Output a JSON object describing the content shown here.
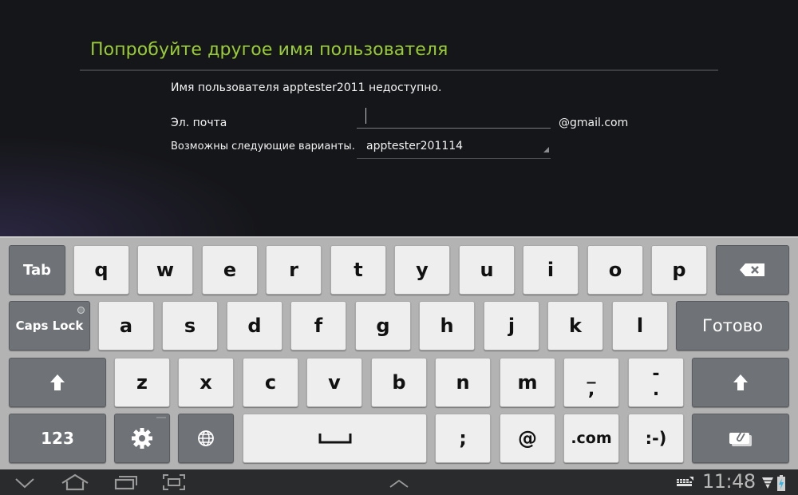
{
  "screen": {
    "title": "Попробуйте другое имя пользователя",
    "message": "Имя пользователя apptester2011 недоступно.",
    "email_label": "Эл. почта",
    "email_value": "",
    "email_domain": "@gmail.com",
    "variants_label": "Возможны следующие варианты.",
    "variants_selected": "apptester201114"
  },
  "keyboard": {
    "row1": [
      "q",
      "w",
      "e",
      "r",
      "t",
      "y",
      "u",
      "i",
      "o",
      "p"
    ],
    "row2": [
      "a",
      "s",
      "d",
      "f",
      "g",
      "h",
      "j",
      "k",
      "l"
    ],
    "row3": [
      "z",
      "x",
      "c",
      "v",
      "b",
      "n",
      "m"
    ],
    "tab_label": "Tab",
    "caps_label": "Caps Lock",
    "done_label": "Готово",
    "numbers_label": "123",
    "comma_key": {
      "top": "_",
      "bottom": ","
    },
    "period_key": {
      "top": "-",
      "bottom": "."
    },
    "semicolon_label": ";",
    "at_label": "@",
    "dotcom_label": ".com",
    "smiley_label": ":-)",
    "icons": {
      "backspace": "backspace-icon",
      "shift": "shift-arrow-icon",
      "settings": "gear-icon",
      "language": "globe-icon",
      "space": "space-bar-icon",
      "clipboard": "clipboard-icon"
    }
  },
  "navbar": {
    "icons": [
      "back-chevron-down-icon",
      "home-icon",
      "recent-apps-icon",
      "screenshot-icon",
      "up-chevron-icon",
      "keyboard-icon",
      "wifi-icon",
      "battery-icon"
    ],
    "time": "11:48"
  }
}
